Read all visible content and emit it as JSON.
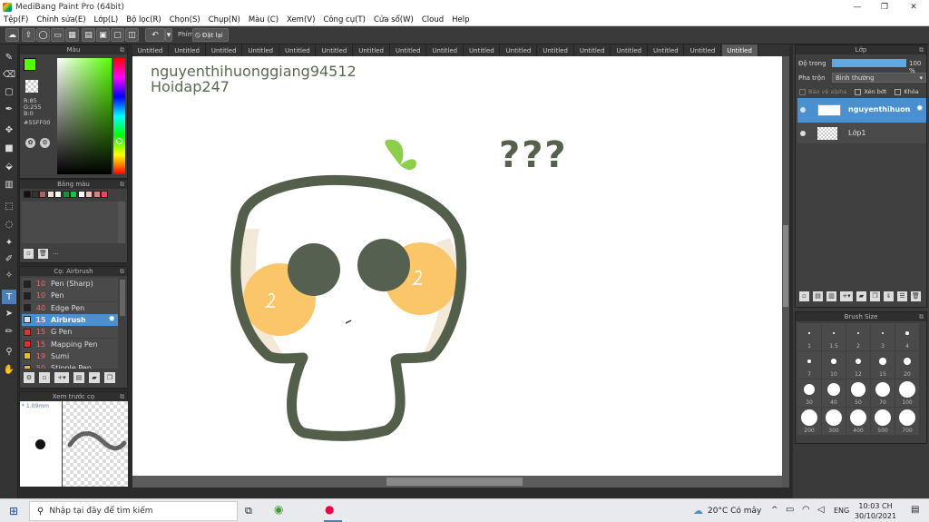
{
  "window": {
    "title": "MediBang Paint Pro (64bit)"
  },
  "menu": [
    "Tệp(F)",
    "Chỉnh sửa(E)",
    "Lớp(L)",
    "Bộ lọc(R)",
    "Chọn(S)",
    "Chụp(N)",
    "Màu (C)",
    "Xem(V)",
    "Công cụ(T)",
    "Cửa sổ(W)",
    "Cloud",
    "Help"
  ],
  "toolbar": {
    "key_label": "Phím",
    "reset_label": "Đặt lại"
  },
  "tabs": [
    "Untitled",
    "Untitled",
    "Untitled",
    "Untitled",
    "Untitled",
    "Untitled",
    "Untitled",
    "Untitled",
    "Untitled",
    "Untitled",
    "Untitled",
    "Untitled",
    "Untitled",
    "Untitled",
    "Untitled",
    "Untitled",
    "Untitled"
  ],
  "color_panel": {
    "title": "Màu",
    "r": "R:85",
    "g": "G:255",
    "b": "B:0",
    "hex": "#55FF00",
    "fg": "#55ff00",
    "bg": "#ffffff"
  },
  "palette_panel": {
    "title": "Bảng màu",
    "swatches": [
      "#111111",
      "#333333",
      "#b06060",
      "#f0e0d0",
      "#ffffff",
      "#1d8f3a",
      "#00cc44",
      "#ffffff",
      "#f0c0c0",
      "#e08080",
      "#ff4060"
    ],
    "dots": "..."
  },
  "brush_panel": {
    "title": "Cọ: Airbrush",
    "brushes": [
      {
        "size": "10",
        "name": "Pen (Sharp)",
        "color": "#222222"
      },
      {
        "size": "10",
        "name": "Pen",
        "color": "#222222"
      },
      {
        "size": "40",
        "name": "Edge Pen",
        "color": "#222222"
      },
      {
        "size": "15",
        "name": "Airbrush",
        "color": "#dddddd",
        "active": true
      },
      {
        "size": "15",
        "name": "G Pen",
        "color": "#e03030"
      },
      {
        "size": "15",
        "name": "Mapping Pen",
        "color": "#e03030"
      },
      {
        "size": "19",
        "name": "Sumi",
        "color": "#e0c020"
      },
      {
        "size": "50",
        "name": "Stipple Pen",
        "color": "#e0c020"
      }
    ]
  },
  "preview_panel": {
    "title": "Xem trước cọ",
    "size": "* 1.09mm"
  },
  "layer_panel": {
    "title": "Lớp",
    "opacity_label": "Độ trong",
    "opacity_value": "100 %",
    "opacity_fraction": 1.0,
    "blend_label": "Pha trộn",
    "blend_value": "Bình thường",
    "protect_alpha": "Bảo vệ alpha",
    "clipping": "Xén bớt",
    "lock": "Khóa",
    "layers": [
      {
        "name": "nguyenthihuon",
        "active": true
      },
      {
        "name": "Lớp1",
        "active": false
      }
    ]
  },
  "brush_size_panel": {
    "title": "Brush Size",
    "sizes": [
      "1",
      "1.5",
      "2",
      "3",
      "4",
      "7",
      "10",
      "12",
      "15",
      "20",
      "30",
      "40",
      "50",
      "70",
      "100",
      "200",
      "300",
      "400",
      "500",
      "700"
    ]
  },
  "canvas": {
    "text_line1": "nguyenthihuonggiang94512",
    "text_line2": "Hoidap247",
    "question": "???"
  },
  "taskbar": {
    "search_placeholder": "Nhập tại đây để tìm kiếm",
    "weather": "20°C  Có mây",
    "lang": "ENG",
    "time": "10:03 CH",
    "date": "30/10/2021"
  }
}
